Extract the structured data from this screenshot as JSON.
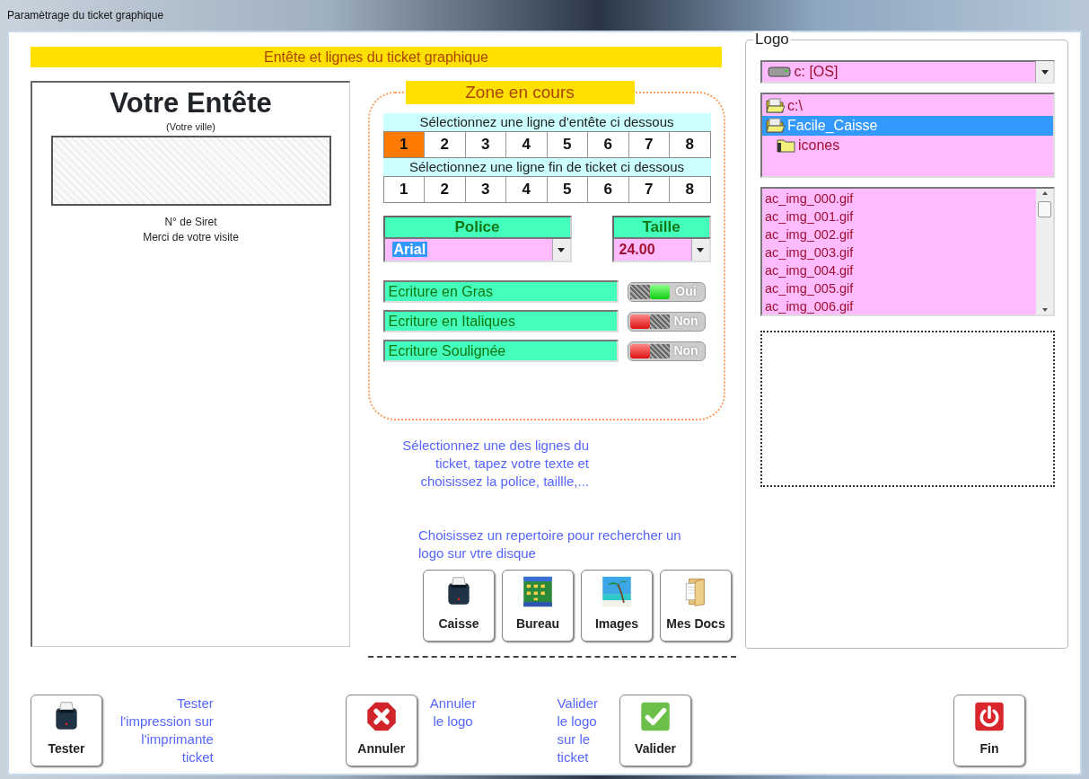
{
  "window": {
    "title": "Paramètrage du ticket graphique"
  },
  "banner": "Entête et lignes du ticket graphique",
  "preview": {
    "heading": "Votre Entête",
    "city": "(Votre ville)",
    "lines": [
      "N° de Siret",
      "Merci de votre visite"
    ]
  },
  "zone": {
    "title": "Zone en cours",
    "header_prompt": "Sélectionnez une ligne d'entête ci dessous",
    "header_lines": [
      {
        "label": "1",
        "selected": true
      },
      {
        "label": "2",
        "selected": false
      },
      {
        "label": "3",
        "selected": false
      },
      {
        "label": "4",
        "selected": false
      },
      {
        "label": "5",
        "selected": false
      },
      {
        "label": "6",
        "selected": false
      },
      {
        "label": "7",
        "selected": false
      },
      {
        "label": "8",
        "selected": false
      }
    ],
    "footer_prompt": "Sélectionnez une ligne fin de ticket ci dessous",
    "footer_lines": [
      {
        "label": "1",
        "selected": false
      },
      {
        "label": "2",
        "selected": false
      },
      {
        "label": "3",
        "selected": false
      },
      {
        "label": "4",
        "selected": false
      },
      {
        "label": "5",
        "selected": false
      },
      {
        "label": "6",
        "selected": false
      },
      {
        "label": "7",
        "selected": false
      },
      {
        "label": "8",
        "selected": false
      }
    ],
    "font": {
      "label": "Police",
      "value": "Arial"
    },
    "size": {
      "label": "Taille",
      "value": "24.00"
    },
    "styles": [
      {
        "label": "Ecriture en Gras",
        "on": true,
        "state": "Oui"
      },
      {
        "label": "Ecriture en Italiques",
        "on": false,
        "state": "Non"
      },
      {
        "label": "Ecriture Soulignée",
        "on": false,
        "state": "Non"
      }
    ]
  },
  "help_text": "Sélectionnez une des lignes du\nticket, tapez votre texte et\nchoisissez la police, taillle,...",
  "folder_prompt": "Choisissez un repertoire pour rechercher un\nlogo sur vtre disque",
  "folder_buttons": [
    {
      "label": "Caisse",
      "kind": "printer"
    },
    {
      "label": "Bureau",
      "kind": "desktop"
    },
    {
      "label": "Images",
      "kind": "beach"
    },
    {
      "label": "Mes Docs",
      "kind": "documents"
    }
  ],
  "logo": {
    "title": "Logo",
    "drive": "c: [OS]",
    "folders": [
      {
        "label": "c:\\",
        "open": true,
        "selected": false
      },
      {
        "label": "Facile_Caisse",
        "open": true,
        "selected": true,
        "children": [
          {
            "label": "icones",
            "open": false,
            "selected": false
          }
        ]
      }
    ],
    "files": [
      "ac_img_000.gif",
      "ac_img_001.gif",
      "ac_img_002.gif",
      "ac_img_003.gif",
      "ac_img_004.gif",
      "ac_img_005.gif",
      "ac_img_006.gif"
    ]
  },
  "actions": [
    {
      "label": "Tester",
      "kind": "printer",
      "note": "Tester\nl'impression sur\nl'imprimante\nticket"
    },
    {
      "label": "Annuler",
      "kind": "cancel",
      "note": "Annuler\nle logo"
    },
    {
      "label": "Valider",
      "kind": "validate",
      "note": "Valider\nle logo\nsur le\nticket"
    },
    {
      "label": "Fin",
      "kind": "power"
    }
  ]
}
